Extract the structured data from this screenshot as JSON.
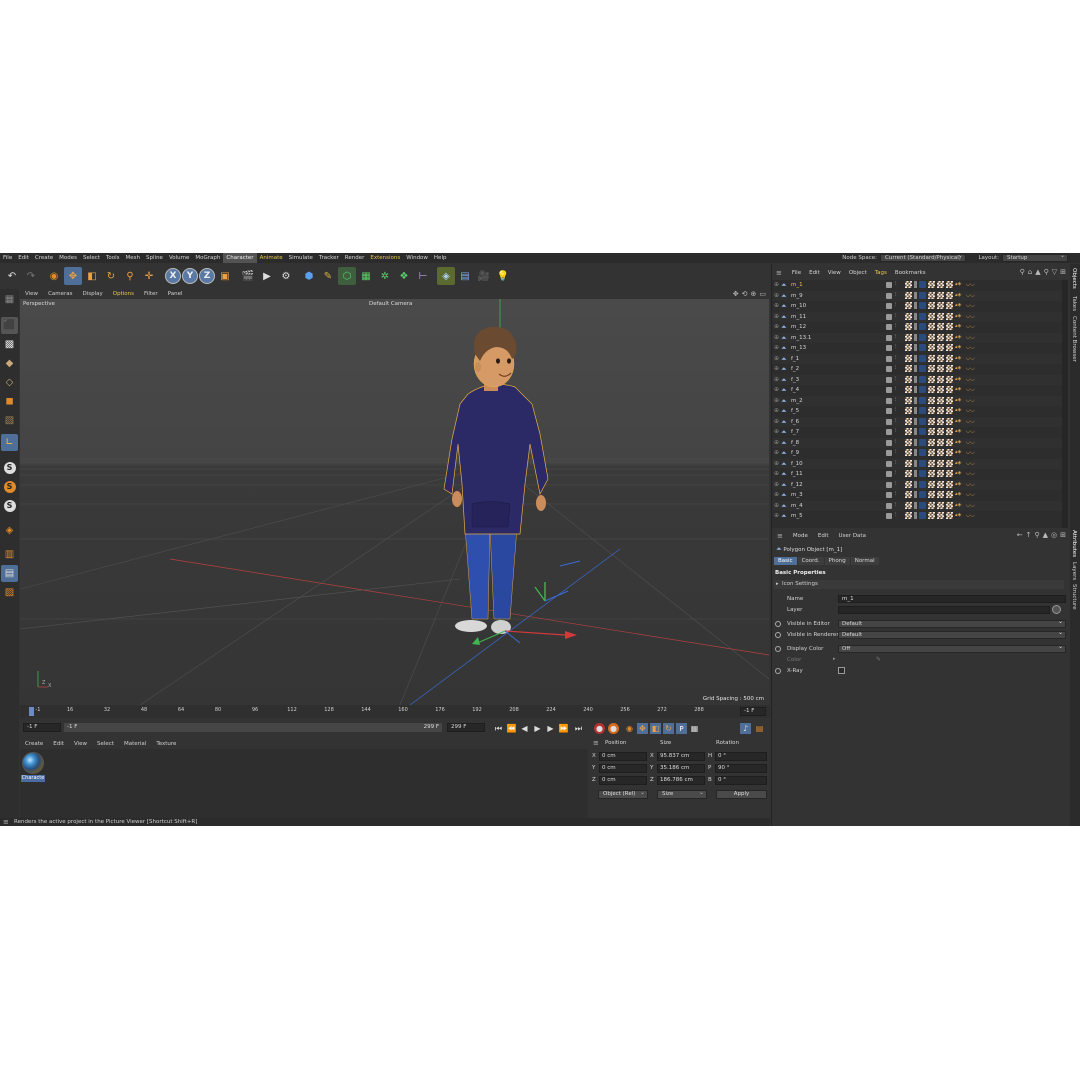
{
  "menubar": {
    "items": [
      {
        "label": "File"
      },
      {
        "label": "Edit"
      },
      {
        "label": "Create"
      },
      {
        "label": "Modes"
      },
      {
        "label": "Select"
      },
      {
        "label": "Tools"
      },
      {
        "label": "Mesh"
      },
      {
        "label": "Spline"
      },
      {
        "label": "Volume"
      },
      {
        "label": "MoGraph"
      },
      {
        "label": "Character"
      },
      {
        "label": "Animate"
      },
      {
        "label": "Simulate"
      },
      {
        "label": "Tracker"
      },
      {
        "label": "Render"
      },
      {
        "label": "Extensions"
      },
      {
        "label": "Window"
      },
      {
        "label": "Help"
      }
    ],
    "active_item": "Character",
    "node_space_label": "Node Space:",
    "node_space_value": "Current (Standard/Physical)",
    "layout_label": "Layout:",
    "layout_value": "Startup"
  },
  "toolbar": {
    "axis_x": "X",
    "axis_y": "Y",
    "axis_z": "Z"
  },
  "viewport": {
    "menu": [
      {
        "label": "View"
      },
      {
        "label": "Cameras"
      },
      {
        "label": "Display"
      },
      {
        "label": "Options"
      },
      {
        "label": "Filter"
      },
      {
        "label": "Panel"
      }
    ],
    "title": "Perspective",
    "camera": "Default Camera",
    "grid_spacing": "Grid Spacing : 500 cm",
    "axis_z_label": "Z",
    "axis_x_label": "X"
  },
  "timeline": {
    "ticks": [
      "-1",
      "16",
      "32",
      "48",
      "64",
      "80",
      "96",
      "112",
      "128",
      "144",
      "160",
      "176",
      "192",
      "208",
      "224",
      "240",
      "256",
      "272",
      "288"
    ],
    "current_frame": "-1 F"
  },
  "transport": {
    "start_field": "-1 F",
    "range_start": "-1 F",
    "range_end": "299 F",
    "end_field": "299 F"
  },
  "material_manager": {
    "menu": [
      {
        "label": "Create"
      },
      {
        "label": "Edit"
      },
      {
        "label": "View"
      },
      {
        "label": "Select"
      },
      {
        "label": "Material"
      },
      {
        "label": "Texture"
      }
    ],
    "material_name": "Characte"
  },
  "coordinates": {
    "headers": {
      "position": "Position",
      "size": "Size",
      "rotation": "Rotation"
    },
    "rows": [
      {
        "axis": "X",
        "pos": "0 cm",
        "size_axis": "X",
        "size": "95.837 cm",
        "rot_axis": "H",
        "rot": "0 °"
      },
      {
        "axis": "Y",
        "pos": "0 cm",
        "size_axis": "Y",
        "size": "35.186 cm",
        "rot_axis": "P",
        "rot": "90 °"
      },
      {
        "axis": "Z",
        "pos": "0 cm",
        "size_axis": "Z",
        "size": "186.786 cm",
        "rot_axis": "B",
        "rot": "0 °"
      }
    ],
    "mode_value": "Object (Rel)",
    "size_mode_value": "Size",
    "apply_label": "Apply"
  },
  "statusbar": {
    "text": "Renders the active project in the Picture Viewer [Shortcut Shift+R]"
  },
  "object_manager": {
    "menu": [
      {
        "label": "File"
      },
      {
        "label": "Edit"
      },
      {
        "label": "View"
      },
      {
        "label": "Object"
      },
      {
        "label": "Tags"
      },
      {
        "label": "Bookmarks"
      }
    ],
    "objects": [
      {
        "name": "m_1"
      },
      {
        "name": "m_9"
      },
      {
        "name": "m_10"
      },
      {
        "name": "m_11"
      },
      {
        "name": "m_12"
      },
      {
        "name": "m_13.1"
      },
      {
        "name": "m_13"
      },
      {
        "name": "f_1"
      },
      {
        "name": "f_2"
      },
      {
        "name": "f_3"
      },
      {
        "name": "f_4"
      },
      {
        "name": "m_2"
      },
      {
        "name": "f_5"
      },
      {
        "name": "f_6"
      },
      {
        "name": "f_7"
      },
      {
        "name": "f_8"
      },
      {
        "name": "f_9"
      },
      {
        "name": "f_10"
      },
      {
        "name": "f_11"
      },
      {
        "name": "f_12"
      },
      {
        "name": "m_3"
      },
      {
        "name": "m_4"
      },
      {
        "name": "m_5"
      }
    ],
    "selected": "m_1"
  },
  "attribute_manager": {
    "menu": [
      {
        "label": "Mode"
      },
      {
        "label": "Edit"
      },
      {
        "label": "User Data"
      }
    ],
    "title": "Polygon Object [m_1]",
    "tabs": [
      {
        "label": "Basic"
      },
      {
        "label": "Coord."
      },
      {
        "label": "Phong"
      },
      {
        "label": "Normal"
      }
    ],
    "active_tab": "Basic",
    "section": "Basic Properties",
    "icon_settings": "Icon Settings",
    "fields": {
      "name_label": "Name",
      "name_value": "m_1",
      "layer_label": "Layer",
      "visible_editor_label": "Visible in Editor",
      "visible_editor_value": "Default",
      "visible_renderer_label": "Visible in Renderer",
      "visible_renderer_value": "Default",
      "display_color_label": "Display Color",
      "display_color_value": "Off",
      "color_label": "Color",
      "xray_label": "X-Ray"
    }
  },
  "side_tabs": [
    {
      "label": "Objects"
    },
    {
      "label": "Takes"
    },
    {
      "label": "Content Browser"
    },
    {
      "label": "Attributes"
    },
    {
      "label": "Layers"
    },
    {
      "label": "Structure"
    }
  ],
  "colors": {
    "accent": "#4f6f98",
    "highlight": "#e6c84a",
    "x_axis": "#d23a3a",
    "y_axis": "#3fb74f",
    "z_axis": "#3a6bd2",
    "hoodie": "#2c2a66",
    "jeans": "#2e4fae"
  }
}
